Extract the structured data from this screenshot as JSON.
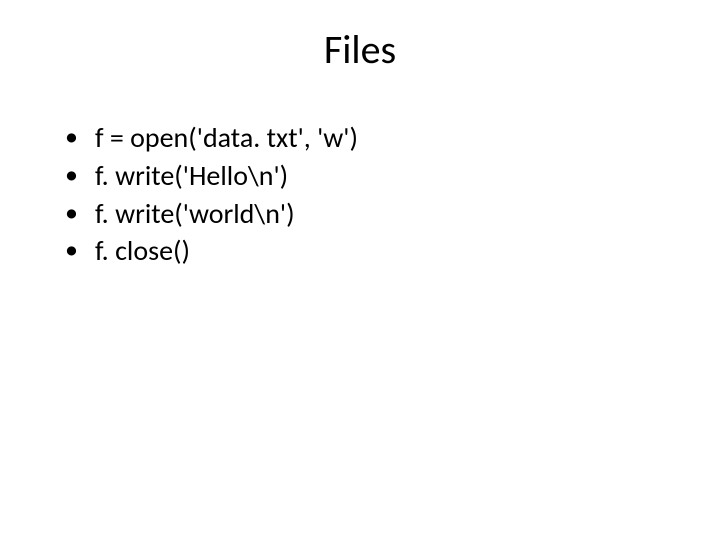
{
  "title": "Files",
  "bullets": {
    "0": "f = open('data. txt', 'w')",
    "1": "f. write('Hello\\n')",
    "2": "f. write('world\\n')",
    "3": "f. close()"
  }
}
